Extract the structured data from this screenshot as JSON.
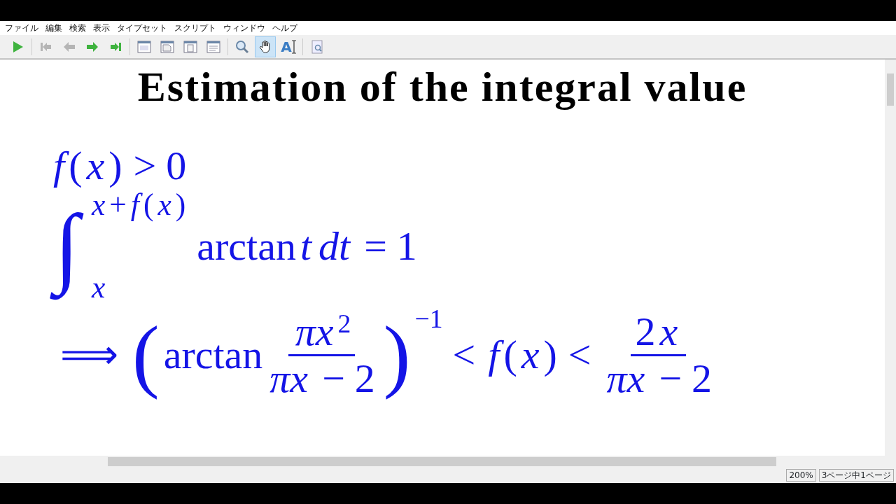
{
  "menu": [
    "ファイル",
    "編集",
    "検索",
    "表示",
    "タイプセット",
    "スクリプト",
    "ウィンドウ",
    "ヘルプ"
  ],
  "toolbar": [
    {
      "kind": "play",
      "disabled": false,
      "selected": false
    },
    {
      "kind": "sep"
    },
    {
      "kind": "first",
      "disabled": true,
      "selected": false
    },
    {
      "kind": "prev",
      "disabled": true,
      "selected": false
    },
    {
      "kind": "next",
      "disabled": false,
      "selected": false
    },
    {
      "kind": "last",
      "disabled": false,
      "selected": false
    },
    {
      "kind": "sep"
    },
    {
      "kind": "page-single",
      "disabled": false,
      "selected": false
    },
    {
      "kind": "page-fold",
      "disabled": false,
      "selected": false
    },
    {
      "kind": "page-doc",
      "disabled": false,
      "selected": false
    },
    {
      "kind": "page-lines",
      "disabled": false,
      "selected": false
    },
    {
      "kind": "sep"
    },
    {
      "kind": "magnifier",
      "disabled": false,
      "selected": false
    },
    {
      "kind": "hand",
      "disabled": false,
      "selected": true
    },
    {
      "kind": "text-select",
      "label": "A",
      "disabled": false,
      "selected": false
    },
    {
      "kind": "sep"
    },
    {
      "kind": "preview",
      "disabled": false,
      "selected": false
    }
  ],
  "document": {
    "title": "Estimation of the integral value",
    "lines": [
      {
        "parts": [
          {
            "kind": "var",
            "t": "f"
          },
          {
            "kind": "rm",
            "t": "("
          },
          {
            "kind": "var",
            "t": "x"
          },
          {
            "kind": "rm",
            "t": ")"
          },
          {
            "kind": "op",
            "t": ">"
          },
          {
            "kind": "rm",
            "t": "0"
          }
        ]
      },
      {
        "parts": [
          {
            "kind": "int",
            "t": "∫",
            "upper": [
              {
                "kind": "var",
                "t": "x"
              },
              {
                "kind": "rm",
                "t": "+"
              },
              {
                "kind": "var",
                "t": "f"
              },
              {
                "kind": "rm",
                "t": "("
              },
              {
                "kind": "var",
                "t": "x"
              },
              {
                "kind": "rm",
                "t": ")"
              }
            ],
            "lower": [
              {
                "kind": "var",
                "t": "x"
              }
            ]
          },
          {
            "kind": "rm",
            "t": "arctan"
          },
          {
            "kind": "var",
            "t": "t"
          },
          {
            "kind": "var",
            "t": "dt"
          },
          {
            "kind": "op",
            "t": "="
          },
          {
            "kind": "rm",
            "t": "1"
          }
        ]
      },
      {
        "parts": [
          {
            "kind": "op",
            "t": "⟹"
          },
          {
            "kind": "big",
            "t": "("
          },
          {
            "kind": "rm",
            "t": "arctan"
          },
          {
            "kind": "frac",
            "num": [
              {
                "kind": "var",
                "t": "πx"
              },
              {
                "kind": "sup",
                "t": "2"
              }
            ],
            "den": [
              {
                "kind": "var",
                "t": "πx"
              },
              {
                "kind": "op",
                "t": "−"
              },
              {
                "kind": "rm",
                "t": "2"
              }
            ]
          },
          {
            "kind": "big",
            "t": ")"
          },
          {
            "kind": "sup",
            "t": "−1"
          },
          {
            "kind": "op",
            "t": "<"
          },
          {
            "kind": "var",
            "t": "f"
          },
          {
            "kind": "rm",
            "t": "("
          },
          {
            "kind": "var",
            "t": "x"
          },
          {
            "kind": "rm",
            "t": ")"
          },
          {
            "kind": "op",
            "t": "<"
          },
          {
            "kind": "frac",
            "num": [
              {
                "kind": "rm",
                "t": "2"
              },
              {
                "kind": "var",
                "t": "x"
              }
            ],
            "den": [
              {
                "kind": "var",
                "t": "πx"
              },
              {
                "kind": "op",
                "t": "−"
              },
              {
                "kind": "rm",
                "t": "2"
              }
            ]
          }
        ]
      }
    ]
  },
  "status": {
    "zoom": "200%",
    "page": "3ページ中1ページ"
  }
}
